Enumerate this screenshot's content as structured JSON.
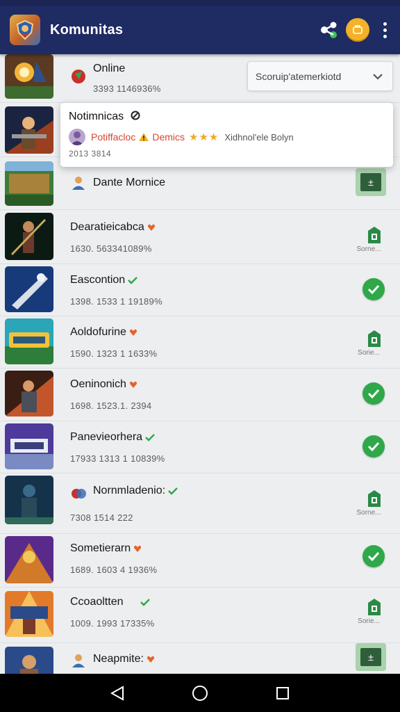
{
  "appbar": {
    "title": "Komunitas"
  },
  "dropdown": {
    "selected": "Scoruip'atemerkiotd"
  },
  "popup": {
    "title": "Notimnicas",
    "user": "Potiffacloc",
    "event": "Demics",
    "stars": "★★★",
    "detail": "Xidhnol'ele Bolyn",
    "meta": "2013   3814"
  },
  "rows": [
    {
      "name": "Online",
      "stats": "3393 1146936%"
    },
    {
      "name": "Dante Mornice",
      "stats": ""
    },
    {
      "name": "Dearatieicabca",
      "stats": "1630. 563341089%",
      "store_label": "Sorne..."
    },
    {
      "name": "Eascontion",
      "stats": "1398. 1533 1 19189%"
    },
    {
      "name": "Aoldofurine",
      "stats": "1590. 1323 1 1633%",
      "store_label": "Sorie..."
    },
    {
      "name": "Oeninonich",
      "stats": "1698. 1523.1. 2394"
    },
    {
      "name": "Panevieorhera",
      "stats": "17933 1313 1 10839%"
    },
    {
      "name": "Nornmladenio:",
      "stats": "7308 1514 222",
      "store_label": "Sorne..."
    },
    {
      "name": "Sometierarn",
      "stats": "1689. 1603 4 1936%"
    },
    {
      "name": "Ccoaoltten",
      "stats": "1009. 1993 17335%",
      "store_label": "Sorie..."
    },
    {
      "name": "Neapmite:",
      "stats": ""
    }
  ],
  "colors": {
    "appbar": "#1f2b63",
    "accent_green": "#2fa84a",
    "coin": "#f3b22a",
    "alert_red": "#d8462f"
  },
  "icons": [
    "app-logo",
    "share-icon",
    "coin-icon",
    "more-vert-icon",
    "chevron-down-icon",
    "check-icon",
    "store-icon",
    "back-icon",
    "home-icon",
    "recents-icon"
  ]
}
